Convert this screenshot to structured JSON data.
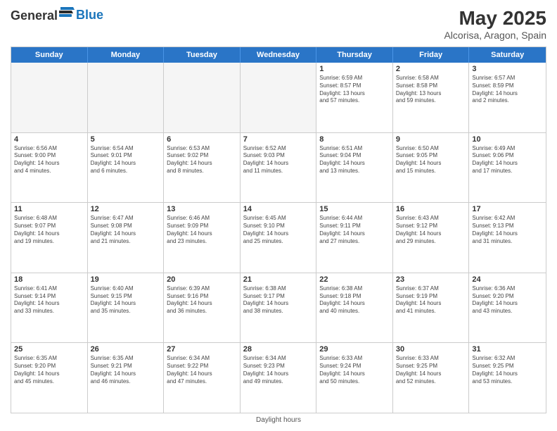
{
  "header": {
    "logo_general": "General",
    "logo_blue": "Blue",
    "title": "May 2025",
    "subtitle": "Alcorisa, Aragon, Spain"
  },
  "weekdays": [
    "Sunday",
    "Monday",
    "Tuesday",
    "Wednesday",
    "Thursday",
    "Friday",
    "Saturday"
  ],
  "footer": {
    "note": "Daylight hours"
  },
  "weeks": [
    [
      {
        "day": "",
        "info": "",
        "shaded": true
      },
      {
        "day": "",
        "info": "",
        "shaded": true
      },
      {
        "day": "",
        "info": "",
        "shaded": true
      },
      {
        "day": "",
        "info": "",
        "shaded": true
      },
      {
        "day": "1",
        "info": "Sunrise: 6:59 AM\nSunset: 8:57 PM\nDaylight: 13 hours\nand 57 minutes."
      },
      {
        "day": "2",
        "info": "Sunrise: 6:58 AM\nSunset: 8:58 PM\nDaylight: 13 hours\nand 59 minutes."
      },
      {
        "day": "3",
        "info": "Sunrise: 6:57 AM\nSunset: 8:59 PM\nDaylight: 14 hours\nand 2 minutes."
      }
    ],
    [
      {
        "day": "4",
        "info": "Sunrise: 6:56 AM\nSunset: 9:00 PM\nDaylight: 14 hours\nand 4 minutes."
      },
      {
        "day": "5",
        "info": "Sunrise: 6:54 AM\nSunset: 9:01 PM\nDaylight: 14 hours\nand 6 minutes."
      },
      {
        "day": "6",
        "info": "Sunrise: 6:53 AM\nSunset: 9:02 PM\nDaylight: 14 hours\nand 8 minutes."
      },
      {
        "day": "7",
        "info": "Sunrise: 6:52 AM\nSunset: 9:03 PM\nDaylight: 14 hours\nand 11 minutes."
      },
      {
        "day": "8",
        "info": "Sunrise: 6:51 AM\nSunset: 9:04 PM\nDaylight: 14 hours\nand 13 minutes."
      },
      {
        "day": "9",
        "info": "Sunrise: 6:50 AM\nSunset: 9:05 PM\nDaylight: 14 hours\nand 15 minutes."
      },
      {
        "day": "10",
        "info": "Sunrise: 6:49 AM\nSunset: 9:06 PM\nDaylight: 14 hours\nand 17 minutes."
      }
    ],
    [
      {
        "day": "11",
        "info": "Sunrise: 6:48 AM\nSunset: 9:07 PM\nDaylight: 14 hours\nand 19 minutes."
      },
      {
        "day": "12",
        "info": "Sunrise: 6:47 AM\nSunset: 9:08 PM\nDaylight: 14 hours\nand 21 minutes."
      },
      {
        "day": "13",
        "info": "Sunrise: 6:46 AM\nSunset: 9:09 PM\nDaylight: 14 hours\nand 23 minutes."
      },
      {
        "day": "14",
        "info": "Sunrise: 6:45 AM\nSunset: 9:10 PM\nDaylight: 14 hours\nand 25 minutes."
      },
      {
        "day": "15",
        "info": "Sunrise: 6:44 AM\nSunset: 9:11 PM\nDaylight: 14 hours\nand 27 minutes."
      },
      {
        "day": "16",
        "info": "Sunrise: 6:43 AM\nSunset: 9:12 PM\nDaylight: 14 hours\nand 29 minutes."
      },
      {
        "day": "17",
        "info": "Sunrise: 6:42 AM\nSunset: 9:13 PM\nDaylight: 14 hours\nand 31 minutes."
      }
    ],
    [
      {
        "day": "18",
        "info": "Sunrise: 6:41 AM\nSunset: 9:14 PM\nDaylight: 14 hours\nand 33 minutes."
      },
      {
        "day": "19",
        "info": "Sunrise: 6:40 AM\nSunset: 9:15 PM\nDaylight: 14 hours\nand 35 minutes."
      },
      {
        "day": "20",
        "info": "Sunrise: 6:39 AM\nSunset: 9:16 PM\nDaylight: 14 hours\nand 36 minutes."
      },
      {
        "day": "21",
        "info": "Sunrise: 6:38 AM\nSunset: 9:17 PM\nDaylight: 14 hours\nand 38 minutes."
      },
      {
        "day": "22",
        "info": "Sunrise: 6:38 AM\nSunset: 9:18 PM\nDaylight: 14 hours\nand 40 minutes."
      },
      {
        "day": "23",
        "info": "Sunrise: 6:37 AM\nSunset: 9:19 PM\nDaylight: 14 hours\nand 41 minutes."
      },
      {
        "day": "24",
        "info": "Sunrise: 6:36 AM\nSunset: 9:20 PM\nDaylight: 14 hours\nand 43 minutes."
      }
    ],
    [
      {
        "day": "25",
        "info": "Sunrise: 6:35 AM\nSunset: 9:20 PM\nDaylight: 14 hours\nand 45 minutes."
      },
      {
        "day": "26",
        "info": "Sunrise: 6:35 AM\nSunset: 9:21 PM\nDaylight: 14 hours\nand 46 minutes."
      },
      {
        "day": "27",
        "info": "Sunrise: 6:34 AM\nSunset: 9:22 PM\nDaylight: 14 hours\nand 47 minutes."
      },
      {
        "day": "28",
        "info": "Sunrise: 6:34 AM\nSunset: 9:23 PM\nDaylight: 14 hours\nand 49 minutes."
      },
      {
        "day": "29",
        "info": "Sunrise: 6:33 AM\nSunset: 9:24 PM\nDaylight: 14 hours\nand 50 minutes."
      },
      {
        "day": "30",
        "info": "Sunrise: 6:33 AM\nSunset: 9:25 PM\nDaylight: 14 hours\nand 52 minutes."
      },
      {
        "day": "31",
        "info": "Sunrise: 6:32 AM\nSunset: 9:25 PM\nDaylight: 14 hours\nand 53 minutes."
      }
    ]
  ]
}
